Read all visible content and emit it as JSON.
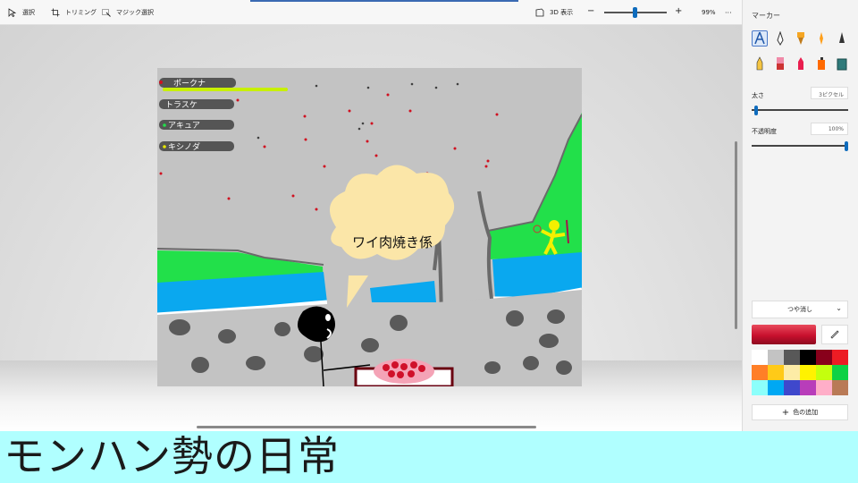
{
  "toolbar": {
    "select_label": "選択",
    "crop_label": "トリミング",
    "magic_select_label": "マジック選択",
    "view_3d_label": "3D 表示",
    "zoom_minus": "−",
    "zoom_plus": "+",
    "zoom_percent": "99%",
    "zoom_level": 0.45,
    "more_label": "···"
  },
  "panel": {
    "title": "マーカー",
    "brushes": [
      "calligraphy-pen",
      "fountain-pen",
      "oil-brush",
      "watercolor",
      "pencil-tip",
      "pencil",
      "eraser",
      "crayon",
      "spray-can",
      "fill-bucket"
    ],
    "selected_brush": 0,
    "thickness_label": "太さ",
    "thickness_value": "3ピクセル",
    "thickness_level": 0.03,
    "opacity_label": "不透明度",
    "opacity_value": "100%",
    "opacity_level": 1.0,
    "finish_value": "つや消し",
    "add_color_label": "色の追加",
    "current_color": "#c8102e",
    "palette": [
      "#ffffff",
      "#c3c3c3",
      "#585858",
      "#000000",
      "#88001b",
      "#ec1c24",
      "#ff7f27",
      "#ffca18",
      "#fdeca6",
      "#fff200",
      "#c4ff0e",
      "#0ed145",
      "#8cfffb",
      "#00a8f3",
      "#3f48cc",
      "#b83dba",
      "#ffaec8",
      "#b97a56"
    ]
  },
  "drawing": {
    "players": [
      "ポークナ",
      "トラスケ",
      "アキュア",
      "キシノダ"
    ],
    "speech": "ワイ肉焼き係"
  },
  "banner": {
    "text": "モンハン勢の日常"
  }
}
